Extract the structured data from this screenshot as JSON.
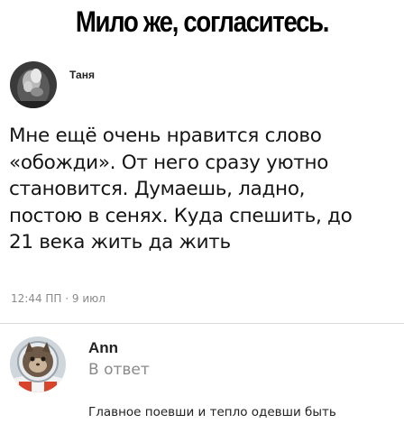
{
  "meme_title": "Мило же, согласитесь.",
  "post": {
    "author": "Таня",
    "text_lines": [
      "Мне ещё очень нравится слово",
      "«обожди». От него сразу уютно",
      "становится. Думаешь, ладно,",
      "постою в сенях. Куда спешить, до",
      "21 века жить да жить"
    ],
    "meta": "12:44 ПП · 9 июл"
  },
  "reply": {
    "author": "Ann",
    "label": "В ответ",
    "text": "Главное поевши и тепло одевши быть"
  }
}
